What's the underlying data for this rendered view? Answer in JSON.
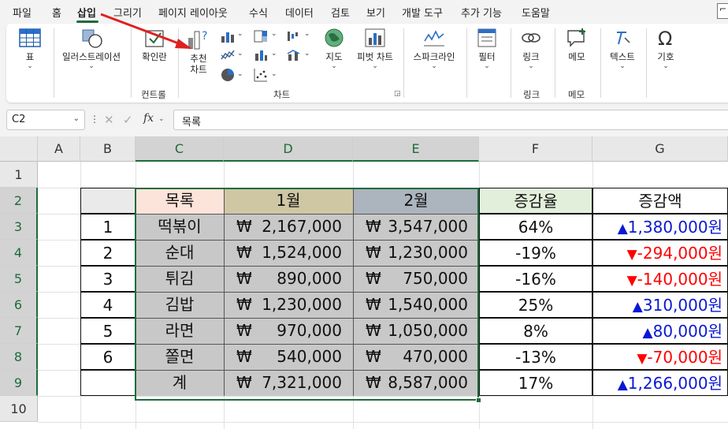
{
  "menu": {
    "items": [
      {
        "label": "파일"
      },
      {
        "label": "홈"
      },
      {
        "label": "삽입"
      },
      {
        "label": "그리기"
      },
      {
        "label": "페이지 레이아웃"
      },
      {
        "label": "수식"
      },
      {
        "label": "데이터"
      },
      {
        "label": "검토"
      },
      {
        "label": "보기"
      },
      {
        "label": "개발 도구"
      },
      {
        "label": "추가 기능"
      },
      {
        "label": "도움말"
      }
    ],
    "active": "삽입"
  },
  "ribbon": {
    "table_label": "표",
    "illustrations_label": "일러스트레이션",
    "checkbox_label": "확인란",
    "controls_group": "컨트롤",
    "recommended_charts_line1": "추천",
    "recommended_charts_line2": "차트",
    "maps_label": "지도",
    "pivot_chart_label": "피벗 차트",
    "charts_group": "차트",
    "sparklines_label": "스파크라인",
    "filter_label": "필터",
    "link_label": "링크",
    "links_group": "링크",
    "comment_label": "메모",
    "comments_group": "메모",
    "text_label": "텍스트",
    "symbols_label": "기호"
  },
  "formula_bar": {
    "name_box": "C2",
    "fx": "fx",
    "formula": "목록"
  },
  "columns": [
    "A",
    "B",
    "C",
    "D",
    "E",
    "F",
    "G"
  ],
  "rows": [
    "1",
    "2",
    "3",
    "4",
    "5",
    "6",
    "7",
    "8",
    "9",
    "10"
  ],
  "table": {
    "headers": {
      "item": "목록",
      "month1": "1월",
      "month2": "2월",
      "rate": "증감율",
      "diff": "증감액"
    },
    "currency": "₩",
    "won": "원",
    "up": "▲",
    "down": "▼",
    "rows": [
      {
        "no": "1",
        "item": "떡볶이",
        "m1": "2,167,000",
        "m2": "3,547,000",
        "rate": "64%",
        "diff": "1,380,000",
        "dir": "up"
      },
      {
        "no": "2",
        "item": "순대",
        "m1": "1,524,000",
        "m2": "1,230,000",
        "rate": "-19%",
        "diff": "-294,000",
        "dir": "down"
      },
      {
        "no": "3",
        "item": "튀김",
        "m1": "890,000",
        "m2": "750,000",
        "rate": "-16%",
        "diff": "-140,000",
        "dir": "down"
      },
      {
        "no": "4",
        "item": "김밥",
        "m1": "1,230,000",
        "m2": "1,540,000",
        "rate": "25%",
        "diff": "310,000",
        "dir": "up"
      },
      {
        "no": "5",
        "item": "라면",
        "m1": "970,000",
        "m2": "1,050,000",
        "rate": "8%",
        "diff": "80,000",
        "dir": "up"
      },
      {
        "no": "6",
        "item": "쫄면",
        "m1": "540,000",
        "m2": "470,000",
        "rate": "-13%",
        "diff": "-70,000",
        "dir": "down"
      }
    ],
    "total": {
      "no": "",
      "item": "계",
      "m1": "7,321,000",
      "m2": "8,587,000",
      "rate": "17%",
      "diff": "1,266,000",
      "dir": "up"
    }
  },
  "colors": {
    "accent_green": "#1e6b3c",
    "header_item_bg": "#fde4da",
    "header_month1_bg": "#cfc7a4",
    "header_month2_bg": "#acb4bd",
    "header_rate_bg": "#e2efda",
    "selection_gray": "#c8c8c8",
    "up_blue": "#0a18d4",
    "down_red": "#ff0000",
    "annotation_red": "#e02020"
  }
}
